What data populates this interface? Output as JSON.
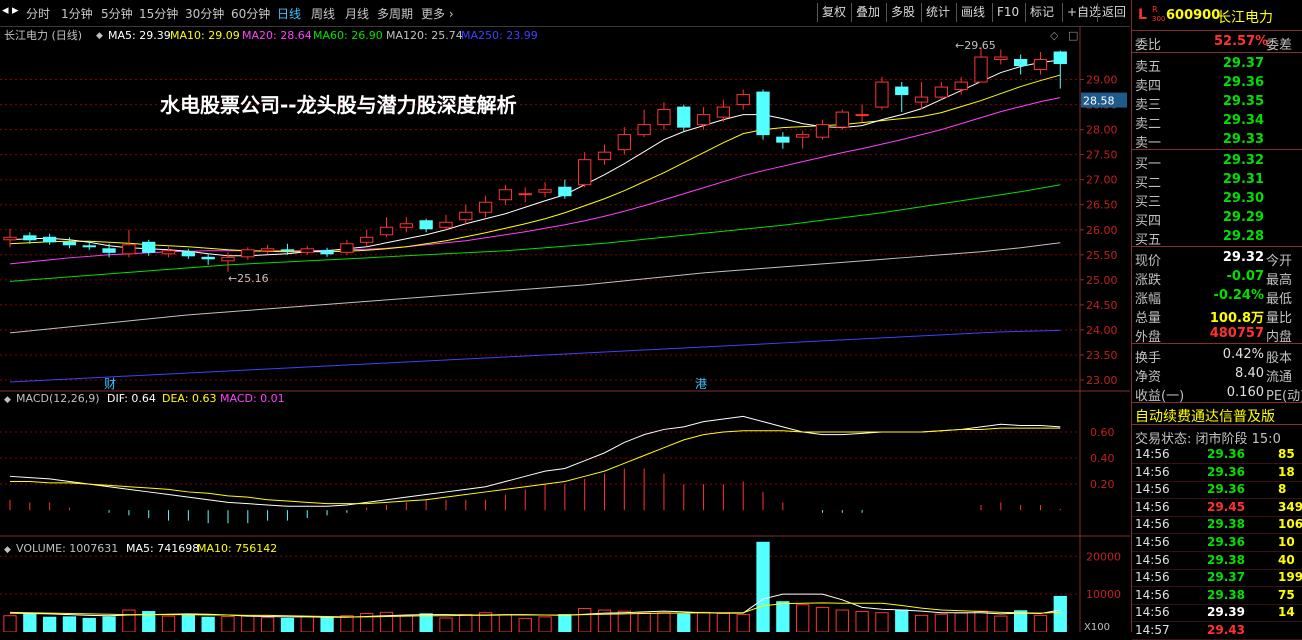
{
  "toolbar": {
    "periods": [
      "分时",
      "1分钟",
      "5分钟",
      "15分钟",
      "30分钟",
      "60分钟",
      "日线",
      "周线",
      "月线",
      "多周期",
      "更多"
    ],
    "selected_period": "日线",
    "right_buttons": [
      "复权",
      "叠加",
      "多股",
      "统计",
      "画线",
      "F10",
      "标记",
      "+自选",
      "返回"
    ]
  },
  "colors": {
    "up": "#ff3232",
    "down": "#54ffff",
    "ma5": "#ffffff",
    "ma10": "#ffff00",
    "ma20": "#ff40ff",
    "ma60": "#00e000",
    "ma120": "#c0c0c0",
    "ma250": "#4040ff",
    "grid": "#8b0000",
    "last_price_bg": "#1e5a8a"
  },
  "legend": {
    "stock": "长江电力 (日线)",
    "ma5": "MA5: 29.39",
    "ma10": "MA10: 29.09",
    "ma20": "MA20: 28.64",
    "ma60": "MA60: 26.90",
    "ma120": "MA120: 25.74",
    "ma250": "MA250: 23.99"
  },
  "overlay_title": "水电股票公司--龙头股与潜力股深度解析",
  "price_annotations": {
    "high": "29.65",
    "low": "25.16",
    "last": "28.58"
  },
  "markers": {
    "cai": "财",
    "gang": "港"
  },
  "macd_legend": {
    "name": "MACD(12,26,9)",
    "dif": "DIF: 0.64",
    "dea": "DEA: 0.63",
    "macd": "MACD: 0.01"
  },
  "volume_legend": {
    "name": "VOLUME: 1007631",
    "ma5": "MA5: 741698",
    "ma10": "MA10: 756142"
  },
  "volume_unit_label": "X100",
  "chart_data": {
    "type": "candlestick",
    "price_axis": {
      "ticks": [
        23.0,
        23.5,
        24.0,
        24.5,
        25.0,
        25.5,
        26.0,
        26.5,
        27.0,
        27.5,
        28.0,
        28.5,
        29.0
      ],
      "min": 22.88,
      "max": 29.75
    },
    "candles": [
      {
        "o": 25.8,
        "c": 25.85,
        "h": 26.02,
        "l": 25.65
      },
      {
        "o": 25.88,
        "c": 25.8,
        "h": 25.95,
        "l": 25.72
      },
      {
        "o": 25.85,
        "c": 25.76,
        "h": 25.92,
        "l": 25.7
      },
      {
        "o": 25.75,
        "c": 25.7,
        "h": 25.85,
        "l": 25.63
      },
      {
        "o": 25.68,
        "c": 25.66,
        "h": 25.78,
        "l": 25.6
      },
      {
        "o": 25.62,
        "c": 25.55,
        "h": 25.72,
        "l": 25.45
      },
      {
        "o": 25.52,
        "c": 25.7,
        "h": 26.0,
        "l": 25.45
      },
      {
        "o": 25.75,
        "c": 25.55,
        "h": 25.8,
        "l": 25.48
      },
      {
        "o": 25.52,
        "c": 25.58,
        "h": 25.66,
        "l": 25.45
      },
      {
        "o": 25.56,
        "c": 25.48,
        "h": 25.62,
        "l": 25.42
      },
      {
        "o": 25.45,
        "c": 25.42,
        "h": 25.52,
        "l": 25.3
      },
      {
        "o": 25.38,
        "c": 25.45,
        "h": 25.55,
        "l": 25.16
      },
      {
        "o": 25.46,
        "c": 25.6,
        "h": 25.65,
        "l": 25.4
      },
      {
        "o": 25.58,
        "c": 25.62,
        "h": 25.7,
        "l": 25.52
      },
      {
        "o": 25.6,
        "c": 25.58,
        "h": 25.72,
        "l": 25.5
      },
      {
        "o": 25.55,
        "c": 25.62,
        "h": 25.68,
        "l": 25.5
      },
      {
        "o": 25.58,
        "c": 25.52,
        "h": 25.64,
        "l": 25.46
      },
      {
        "o": 25.55,
        "c": 25.72,
        "h": 25.8,
        "l": 25.5
      },
      {
        "o": 25.75,
        "c": 25.85,
        "h": 26.0,
        "l": 25.68
      },
      {
        "o": 25.9,
        "c": 26.05,
        "h": 26.25,
        "l": 25.85
      },
      {
        "o": 26.05,
        "c": 26.12,
        "h": 26.25,
        "l": 25.95
      },
      {
        "o": 26.18,
        "c": 26.02,
        "h": 26.22,
        "l": 25.95
      },
      {
        "o": 26.05,
        "c": 26.15,
        "h": 26.3,
        "l": 25.98
      },
      {
        "o": 26.2,
        "c": 26.35,
        "h": 26.5,
        "l": 26.1
      },
      {
        "o": 26.35,
        "c": 26.55,
        "h": 26.68,
        "l": 26.25
      },
      {
        "o": 26.6,
        "c": 26.8,
        "h": 26.9,
        "l": 26.5
      },
      {
        "o": 26.7,
        "c": 26.72,
        "h": 26.85,
        "l": 26.55
      },
      {
        "o": 26.75,
        "c": 26.8,
        "h": 26.95,
        "l": 26.65
      },
      {
        "o": 26.85,
        "c": 26.68,
        "h": 27.0,
        "l": 26.62
      },
      {
        "o": 26.9,
        "c": 27.4,
        "h": 27.55,
        "l": 26.85
      },
      {
        "o": 27.4,
        "c": 27.55,
        "h": 27.7,
        "l": 27.3
      },
      {
        "o": 27.6,
        "c": 27.9,
        "h": 28.05,
        "l": 27.5
      },
      {
        "o": 27.9,
        "c": 28.1,
        "h": 28.4,
        "l": 27.85
      },
      {
        "o": 28.1,
        "c": 28.4,
        "h": 28.55,
        "l": 28.0
      },
      {
        "o": 28.45,
        "c": 28.05,
        "h": 28.5,
        "l": 27.95
      },
      {
        "o": 28.1,
        "c": 28.3,
        "h": 28.45,
        "l": 28.0
      },
      {
        "o": 28.25,
        "c": 28.45,
        "h": 28.6,
        "l": 28.15
      },
      {
        "o": 28.5,
        "c": 28.7,
        "h": 28.8,
        "l": 28.4
      },
      {
        "o": 28.75,
        "c": 27.9,
        "h": 28.8,
        "l": 27.8
      },
      {
        "o": 27.85,
        "c": 27.75,
        "h": 27.95,
        "l": 27.62
      },
      {
        "o": 27.85,
        "c": 27.9,
        "h": 27.98,
        "l": 27.62
      },
      {
        "o": 27.85,
        "c": 28.1,
        "h": 28.2,
        "l": 27.8
      },
      {
        "o": 28.05,
        "c": 28.35,
        "h": 28.4,
        "l": 28.0
      },
      {
        "o": 28.3,
        "c": 28.3,
        "h": 28.5,
        "l": 28.15
      },
      {
        "o": 28.45,
        "c": 28.95,
        "h": 29.05,
        "l": 28.4
      },
      {
        "o": 28.85,
        "c": 28.7,
        "h": 28.95,
        "l": 28.35
      },
      {
        "o": 28.55,
        "c": 28.65,
        "h": 28.95,
        "l": 28.4
      },
      {
        "o": 28.65,
        "c": 28.85,
        "h": 28.95,
        "l": 28.6
      },
      {
        "o": 28.8,
        "c": 28.95,
        "h": 29.05,
        "l": 28.7
      },
      {
        "o": 28.95,
        "c": 29.45,
        "h": 29.65,
        "l": 28.95
      },
      {
        "o": 29.4,
        "c": 29.45,
        "h": 29.6,
        "l": 29.3
      },
      {
        "o": 29.4,
        "c": 29.28,
        "h": 29.5,
        "l": 29.1
      },
      {
        "o": 29.2,
        "c": 29.4,
        "h": 29.55,
        "l": 29.1
      },
      {
        "o": 29.55,
        "c": 29.32,
        "h": 29.58,
        "l": 28.82
      }
    ],
    "ma5": [
      25.8,
      25.82,
      25.83,
      25.8,
      25.75,
      25.68,
      25.64,
      25.62,
      25.6,
      25.57,
      25.52,
      25.48,
      25.48,
      25.5,
      25.52,
      25.56,
      25.58,
      25.62,
      25.66,
      25.74,
      25.82,
      25.9,
      26.0,
      26.12,
      26.22,
      26.32,
      26.45,
      26.58,
      26.7,
      26.9,
      27.1,
      27.32,
      27.56,
      27.8,
      27.96,
      28.08,
      28.2,
      28.3,
      28.3,
      28.22,
      28.12,
      28.06,
      28.04,
      28.08,
      28.2,
      28.3,
      28.42,
      28.6,
      28.78,
      28.96,
      29.14,
      29.26,
      29.34,
      29.39
    ],
    "ma10": [
      25.72,
      25.74,
      25.76,
      25.77,
      25.77,
      25.75,
      25.73,
      25.7,
      25.68,
      25.66,
      25.63,
      25.6,
      25.58,
      25.57,
      25.56,
      25.56,
      25.56,
      25.57,
      25.59,
      25.62,
      25.66,
      25.72,
      25.78,
      25.86,
      25.94,
      26.03,
      26.12,
      26.22,
      26.34,
      26.48,
      26.62,
      26.78,
      26.96,
      27.14,
      27.34,
      27.54,
      27.74,
      27.92,
      28.0,
      28.04,
      28.06,
      28.08,
      28.1,
      28.14,
      28.18,
      28.22,
      28.26,
      28.34,
      28.46,
      28.58,
      28.72,
      28.86,
      28.98,
      29.09
    ],
    "ma20": [
      25.32,
      25.36,
      25.4,
      25.44,
      25.47,
      25.5,
      25.52,
      25.54,
      25.56,
      25.57,
      25.58,
      25.58,
      25.58,
      25.58,
      25.58,
      25.58,
      25.59,
      25.6,
      25.61,
      25.63,
      25.66,
      25.7,
      25.74,
      25.78,
      25.84,
      25.9,
      25.96,
      26.03,
      26.1,
      26.18,
      26.27,
      26.37,
      26.48,
      26.6,
      26.72,
      26.84,
      26.96,
      27.08,
      27.18,
      27.27,
      27.36,
      27.45,
      27.54,
      27.62,
      27.71,
      27.8,
      27.9,
      28.0,
      28.12,
      28.24,
      28.36,
      28.46,
      28.56,
      28.64
    ],
    "ma60": [
      24.97,
      25.0,
      25.03,
      25.06,
      25.09,
      25.12,
      25.15,
      25.18,
      25.21,
      25.24,
      25.27,
      25.3,
      25.32,
      25.34,
      25.36,
      25.38,
      25.4,
      25.42,
      25.44,
      25.46,
      25.48,
      25.5,
      25.52,
      25.54,
      25.56,
      25.58,
      25.61,
      25.64,
      25.67,
      25.7,
      25.73,
      25.77,
      25.81,
      25.85,
      25.89,
      25.93,
      25.97,
      26.01,
      26.05,
      26.09,
      26.14,
      26.19,
      26.24,
      26.29,
      26.34,
      26.4,
      26.46,
      26.52,
      26.58,
      26.64,
      26.7,
      26.76,
      26.83,
      26.9
    ],
    "ma120": [
      23.94,
      23.98,
      24.02,
      24.06,
      24.1,
      24.14,
      24.18,
      24.22,
      24.26,
      24.3,
      24.33,
      24.36,
      24.39,
      24.42,
      24.45,
      24.48,
      24.51,
      24.54,
      24.57,
      24.6,
      24.63,
      24.66,
      24.69,
      24.72,
      24.75,
      24.78,
      24.81,
      24.84,
      24.87,
      24.9,
      24.94,
      24.98,
      25.02,
      25.06,
      25.1,
      25.14,
      25.17,
      25.2,
      25.23,
      25.26,
      25.29,
      25.32,
      25.35,
      25.38,
      25.41,
      25.44,
      25.47,
      25.5,
      25.53,
      25.56,
      25.6,
      25.64,
      25.69,
      25.74
    ],
    "ma250": [
      22.96,
      22.98,
      23.0,
      23.02,
      23.04,
      23.06,
      23.08,
      23.1,
      23.12,
      23.14,
      23.16,
      23.18,
      23.2,
      23.22,
      23.24,
      23.26,
      23.28,
      23.3,
      23.32,
      23.34,
      23.36,
      23.38,
      23.4,
      23.42,
      23.44,
      23.46,
      23.48,
      23.5,
      23.52,
      23.54,
      23.56,
      23.58,
      23.6,
      23.62,
      23.64,
      23.66,
      23.68,
      23.7,
      23.72,
      23.74,
      23.76,
      23.78,
      23.8,
      23.82,
      23.84,
      23.86,
      23.88,
      23.9,
      23.92,
      23.94,
      23.96,
      23.97,
      23.98,
      23.99
    ],
    "macd_axis": {
      "ticks": [
        0.2,
        0.4,
        0.6
      ],
      "min": -0.16,
      "max": 0.8
    },
    "dif": [
      0.26,
      0.25,
      0.24,
      0.22,
      0.2,
      0.18,
      0.16,
      0.14,
      0.12,
      0.1,
      0.08,
      0.06,
      0.05,
      0.04,
      0.03,
      0.03,
      0.03,
      0.04,
      0.06,
      0.08,
      0.1,
      0.12,
      0.14,
      0.16,
      0.18,
      0.22,
      0.26,
      0.3,
      0.32,
      0.38,
      0.44,
      0.52,
      0.58,
      0.62,
      0.64,
      0.68,
      0.7,
      0.72,
      0.68,
      0.64,
      0.6,
      0.58,
      0.58,
      0.59,
      0.6,
      0.6,
      0.6,
      0.61,
      0.62,
      0.64,
      0.66,
      0.65,
      0.65,
      0.64
    ],
    "dea": [
      0.22,
      0.22,
      0.21,
      0.21,
      0.2,
      0.19,
      0.18,
      0.17,
      0.16,
      0.14,
      0.13,
      0.11,
      0.1,
      0.08,
      0.07,
      0.06,
      0.05,
      0.05,
      0.05,
      0.06,
      0.07,
      0.08,
      0.1,
      0.12,
      0.14,
      0.16,
      0.18,
      0.2,
      0.22,
      0.26,
      0.3,
      0.36,
      0.42,
      0.48,
      0.54,
      0.58,
      0.6,
      0.61,
      0.61,
      0.61,
      0.6,
      0.6,
      0.6,
      0.6,
      0.6,
      0.6,
      0.6,
      0.61,
      0.62,
      0.62,
      0.63,
      0.63,
      0.63,
      0.63
    ],
    "macd": [
      0.08,
      0.06,
      0.06,
      0.02,
      0.0,
      -0.02,
      -0.04,
      -0.06,
      -0.08,
      -0.08,
      -0.1,
      -0.1,
      -0.1,
      -0.08,
      -0.08,
      -0.06,
      -0.04,
      -0.02,
      0.02,
      0.04,
      0.06,
      0.08,
      0.08,
      0.08,
      0.08,
      0.12,
      0.16,
      0.2,
      0.2,
      0.24,
      0.28,
      0.32,
      0.32,
      0.28,
      0.2,
      0.2,
      0.2,
      0.22,
      0.14,
      0.06,
      0.0,
      -0.02,
      -0.02,
      -0.02,
      0.0,
      0.0,
      0.0,
      0.0,
      0.0,
      0.04,
      0.06,
      0.04,
      0.04,
      0.01
    ],
    "volume_axis": {
      "ticks": [
        10000,
        20000
      ],
      "min": 0,
      "max": 28000
    },
    "volume": [
      4300,
      4800,
      3900,
      4000,
      3600,
      4000,
      5800,
      5400,
      4200,
      4500,
      3900,
      4100,
      4200,
      3800,
      3600,
      4100,
      3700,
      4300,
      4900,
      5200,
      4300,
      4800,
      3700,
      4600,
      5100,
      4500,
      3600,
      4000,
      4600,
      6200,
      5800,
      5500,
      5000,
      5100,
      4700,
      5200,
      4900,
      4600,
      23700,
      8000,
      7200,
      6500,
      5800,
      5400,
      5100,
      5800,
      4400,
      4700,
      5000,
      5500,
      4200,
      5600,
      4400,
      9400
    ],
    "vol_ma5": [
      5000,
      4900,
      4800,
      4600,
      4400,
      4300,
      4500,
      4600,
      4700,
      4800,
      4700,
      4500,
      4200,
      4100,
      4000,
      4000,
      3900,
      3900,
      4100,
      4300,
      4500,
      4600,
      4600,
      4500,
      4500,
      4600,
      4600,
      4500,
      4400,
      4700,
      5000,
      5100,
      5300,
      5500,
      5300,
      5100,
      5000,
      5000,
      8700,
      10000,
      10000,
      10000,
      8500,
      6500,
      6000,
      5800,
      5500,
      5100,
      5100,
      5100,
      4800,
      5000,
      4900,
      5800
    ],
    "vol_ma10": [
      5200,
      5100,
      5000,
      4900,
      4800,
      4700,
      4600,
      4600,
      4600,
      4600,
      4500,
      4500,
      4400,
      4400,
      4300,
      4200,
      4100,
      4000,
      4000,
      4100,
      4200,
      4300,
      4300,
      4400,
      4400,
      4500,
      4500,
      4500,
      4500,
      4600,
      4700,
      4800,
      4900,
      5000,
      5000,
      5100,
      5100,
      5100,
      6900,
      7500,
      7600,
      7700,
      7600,
      7600,
      7600,
      7000,
      6300,
      5800,
      5600,
      5400,
      5200,
      5100,
      5000,
      5200
    ]
  },
  "quote": {
    "logo_letter": "L",
    "logo_sub1": "R",
    "logo_sub2": "300",
    "code": "600900",
    "name": "长江电力",
    "weibi_label": "委比",
    "weibi_value": "52.57%",
    "weicha_label": "委差",
    "asks": [
      {
        "label": "卖五",
        "price": "29.37"
      },
      {
        "label": "卖四",
        "price": "29.36"
      },
      {
        "label": "卖三",
        "price": "29.35"
      },
      {
        "label": "卖二",
        "price": "29.34"
      },
      {
        "label": "卖一",
        "price": "29.33"
      }
    ],
    "bids": [
      {
        "label": "买一",
        "price": "29.32"
      },
      {
        "label": "买二",
        "price": "29.31"
      },
      {
        "label": "买三",
        "price": "29.30"
      },
      {
        "label": "买四",
        "price": "29.29"
      },
      {
        "label": "买五",
        "price": "29.28"
      }
    ],
    "stats": [
      {
        "l1": "现价",
        "v": "29.32",
        "l2": "今开",
        "color": "#ffffff"
      },
      {
        "l1": "涨跌",
        "v": "-0.07",
        "l2": "最高",
        "color": "#00e000"
      },
      {
        "l1": "涨幅",
        "v": "-0.24%",
        "l2": "最低",
        "color": "#00e000"
      },
      {
        "l1": "总量",
        "v": "100.8万",
        "l2": "量比",
        "color": "#ffff00"
      },
      {
        "l1": "外盘",
        "v": "480757",
        "l2": "内盘",
        "color": "#ff3232"
      }
    ],
    "stats2": [
      {
        "l1": "换手",
        "v": "0.42%",
        "l2": "股本"
      },
      {
        "l1": "净资",
        "v": "8.40",
        "l2": "流通"
      },
      {
        "l1": "收益(一)",
        "v": "0.160",
        "l2": "PE(动)"
      }
    ],
    "promo": "自动续费通达信普及版",
    "trade_status": "交易状态: 闭市阶段 15:0",
    "ticks": [
      {
        "t": "14:56",
        "p": "29.36",
        "v": "85",
        "pc": "#00e000"
      },
      {
        "t": "14:56",
        "p": "29.36",
        "v": "18",
        "pc": "#00e000"
      },
      {
        "t": "14:56",
        "p": "29.36",
        "v": "8",
        "pc": "#00e000"
      },
      {
        "t": "14:56",
        "p": "29.45",
        "v": "349",
        "pc": "#ff3232"
      },
      {
        "t": "14:56",
        "p": "29.38",
        "v": "106",
        "pc": "#00e000"
      },
      {
        "t": "14:56",
        "p": "29.36",
        "v": "10",
        "pc": "#00e000"
      },
      {
        "t": "14:56",
        "p": "29.38",
        "v": "40",
        "pc": "#00e000"
      },
      {
        "t": "14:56",
        "p": "29.37",
        "v": "199",
        "pc": "#00e000"
      },
      {
        "t": "14:56",
        "p": "29.38",
        "v": "75",
        "pc": "#00e000"
      },
      {
        "t": "14:56",
        "p": "29.39",
        "v": "14",
        "pc": "#ffffff"
      },
      {
        "t": "14:57",
        "p": "29.43",
        "v": "",
        "pc": "#ff3232"
      }
    ]
  }
}
